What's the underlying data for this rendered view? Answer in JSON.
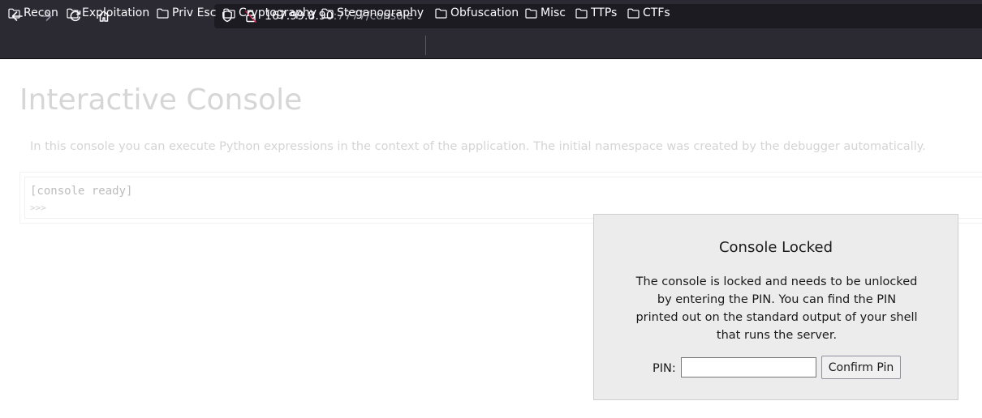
{
  "browser": {
    "icons": {
      "back": "arrow-left-icon",
      "forward": "arrow-right-icon",
      "reload": "reload-icon",
      "home": "home-icon",
      "tracking_protection": "shield-icon",
      "insecure_connection": "lock-strikethrough-icon",
      "bookmark_folder": "folder-icon"
    },
    "forward_disabled": true,
    "url": {
      "host": "167.99.8.90",
      "rest": ":7777/console"
    },
    "bookmarks": [
      "Recon",
      "Exploitation",
      "Priv Esc",
      "Cryptography",
      "Steganography",
      "Obfuscation",
      "Misc",
      "TTPs",
      "CTFs"
    ]
  },
  "page": {
    "title": "Interactive Console",
    "description": "In this console you can execute Python expressions in the context of the application. The initial namespace was created by the debugger automatically.",
    "console": {
      "ready_text": "[console ready]",
      "prompt": ">>>"
    }
  },
  "lock_dialog": {
    "title": "Console Locked",
    "message": "The console is locked and needs to be unlocked by entering the PIN. You can find the PIN printed out on the standard output of your shell that runs the server.",
    "pin_label": "PIN:",
    "pin_value": "",
    "confirm_label": "Confirm Pin"
  },
  "colors": {
    "chrome_bg": "#2b2a33",
    "urlbar_bg": "#1c1b22",
    "chrome_text": "#fbfbfe",
    "insecure_accent": "#e22850",
    "faded_text": "#d6d6d6",
    "dialog_bg": "#ececec"
  }
}
